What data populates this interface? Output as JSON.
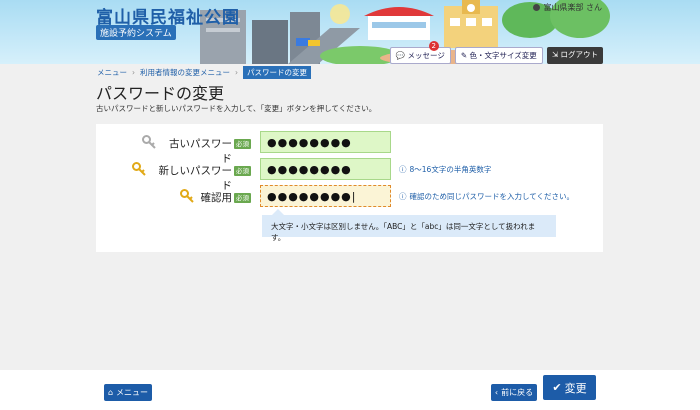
{
  "header": {
    "title": "富山県民福祉公園",
    "subtitle": "施設予約システム",
    "user": "富山県楽部 さん",
    "message_label": "メッセージ",
    "message_count": "2",
    "color_label": "色・文字サイズ変更",
    "logout_label": "ログアウト"
  },
  "breadcrumbs": [
    "メニュー",
    "利用者情報の変更メニュー",
    "パスワードの変更"
  ],
  "page": {
    "title": "パスワードの変更",
    "instruction": "古いパスワードと新しいパスワードを入力して、「変更」ボタンを押してください。"
  },
  "form": {
    "required": "必須",
    "old_label": "古いパスワード",
    "old_value": "●●●●●●●●",
    "new_label": "新しいパスワード",
    "new_value": "●●●●●●●●",
    "new_hint": "8～16文字の半角英数字",
    "confirm_label": "確認用",
    "confirm_value": "●●●●●●●●|",
    "confirm_hint": "確認のため同じパスワードを入力してください。",
    "tip": "大文字・小文字は区別しません。「ABC」と「abc」は同一文字として扱われます。"
  },
  "footer": {
    "menu_label": "メニュー",
    "back_label": "前に戻る",
    "submit_label": "変更"
  },
  "colors": {
    "accent": "#1d5ca8",
    "field_bg": "#def7c7",
    "required": "#6aa84f"
  }
}
